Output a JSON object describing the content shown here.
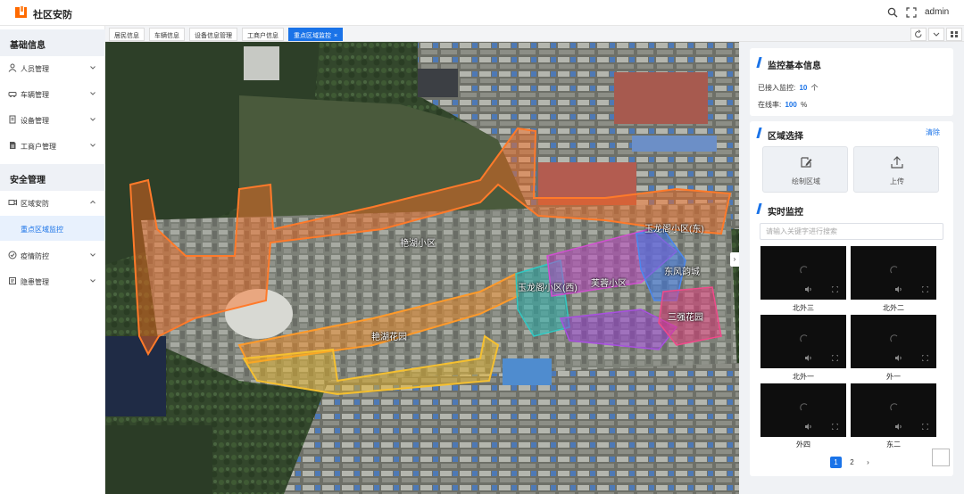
{
  "app": {
    "title": "社区安防",
    "user": "admin"
  },
  "sidebar": {
    "sections": [
      {
        "label": "基础信息"
      },
      {
        "label": "安全管理"
      }
    ],
    "items": [
      {
        "label": "人员管理",
        "icon": "user-icon"
      },
      {
        "label": "车辆管理",
        "icon": "car-icon"
      },
      {
        "label": "设备管理",
        "icon": "device-icon"
      },
      {
        "label": "工商户管理",
        "icon": "merchant-icon"
      },
      {
        "label": "区域安防",
        "icon": "camera-icon"
      },
      {
        "label": "重点区域监控"
      },
      {
        "label": "疫情防控",
        "icon": "shield-icon"
      },
      {
        "label": "隐患管理",
        "icon": "hazard-icon"
      }
    ]
  },
  "tabs": [
    {
      "label": "居民信息"
    },
    {
      "label": "车辆信息"
    },
    {
      "label": "设备信息管理"
    },
    {
      "label": "工商户信息"
    },
    {
      "label": "重点区域监控",
      "close": "×"
    }
  ],
  "map": {
    "labels": [
      "艳湖小区",
      "玉龙阁小区(东)",
      "东风韵城",
      "芙蓉小区",
      "玉龙阁小区(西)",
      "三强花园",
      "艳湖花园"
    ],
    "collapse": "›"
  },
  "monitor_info": {
    "title": "监控基本信息",
    "connected_label": "已接入监控:",
    "connected_value": "10",
    "connected_unit": "个",
    "online_label": "在线率:",
    "online_value": "100",
    "online_unit": "%"
  },
  "area_select": {
    "title": "区域选择",
    "clear": "清除",
    "draw": "绘制区域",
    "upload": "上传"
  },
  "realtime": {
    "title": "实时监控",
    "search_placeholder": "请输入关键字进行搜索",
    "cameras": [
      {
        "name": "北外三"
      },
      {
        "name": "北外二"
      },
      {
        "name": "北外一"
      },
      {
        "name": "外一"
      },
      {
        "name": "外四"
      },
      {
        "name": "东二"
      }
    ],
    "pages": [
      "1",
      "2"
    ],
    "next": "›"
  },
  "colors": {
    "accent": "#1a73e8"
  }
}
